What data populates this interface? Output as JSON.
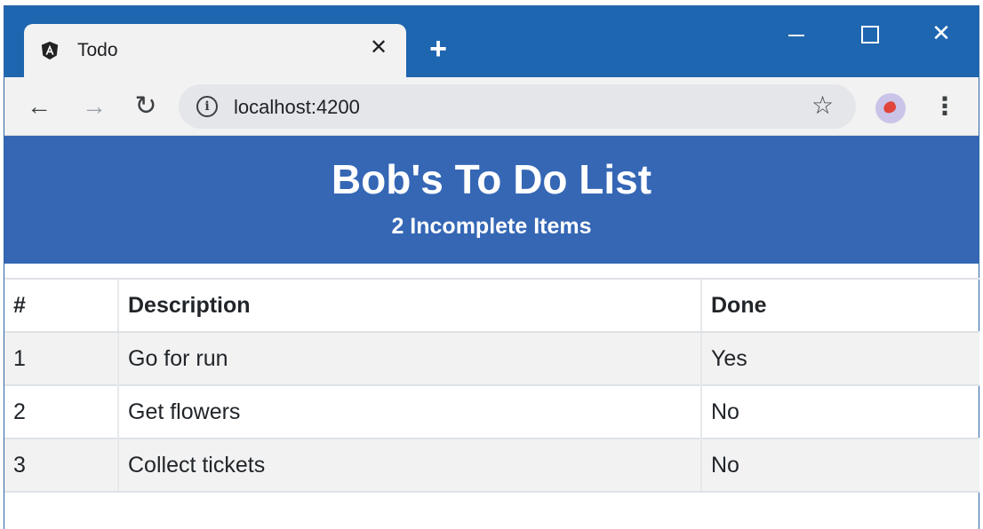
{
  "browser": {
    "tab_title": "Todo",
    "tab_icon": "angular-icon",
    "url": "localhost:4200",
    "accent_color": "#1f66b0"
  },
  "page": {
    "title": "Bob's To Do List",
    "subtitle": "2 Incomplete Items",
    "header_color": "#3567b5"
  },
  "table": {
    "headers": [
      "#",
      "Description",
      "Done"
    ],
    "rows": [
      {
        "num": "1",
        "description": "Go for run",
        "done": "Yes"
      },
      {
        "num": "2",
        "description": "Get flowers",
        "done": "No"
      },
      {
        "num": "3",
        "description": "Collect tickets",
        "done": "No"
      }
    ]
  }
}
